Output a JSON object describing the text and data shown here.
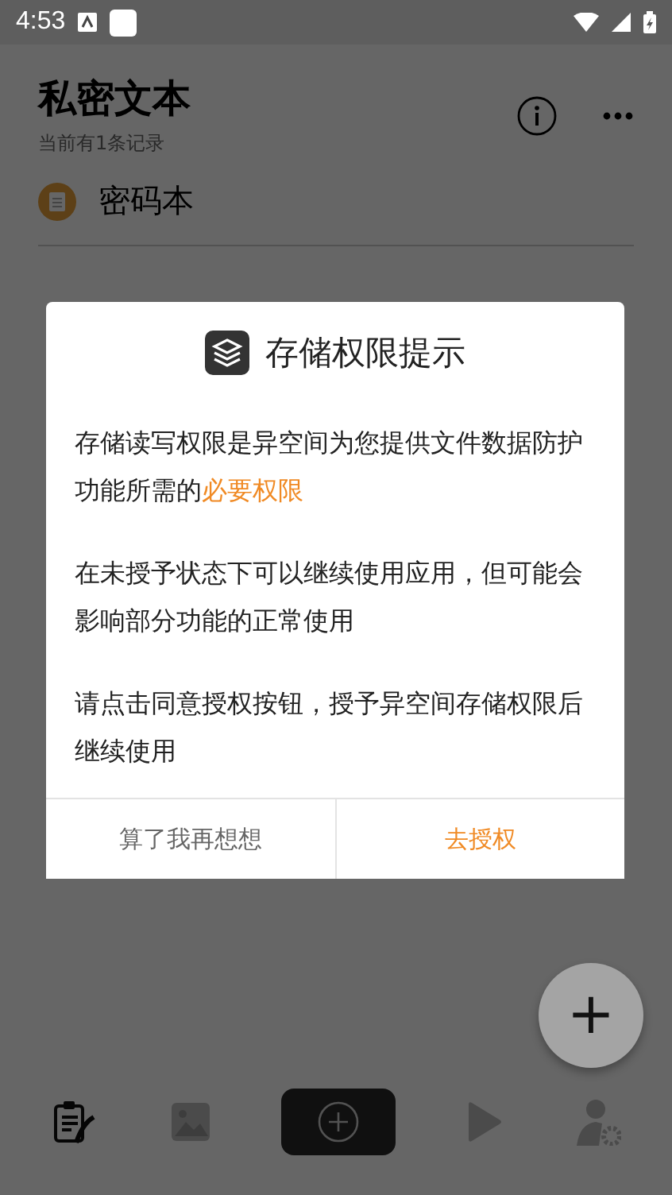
{
  "status_bar": {
    "time": "4:53"
  },
  "app_bar": {
    "title": "私密文本",
    "subtitle": "当前有1条记录"
  },
  "items": [
    {
      "name": "密码本"
    }
  ],
  "dialog": {
    "title": "存储权限提示",
    "paragraphs": [
      {
        "text": "存储读写权限是异空间为您提供文件数据防护功能所需的",
        "link": "必要权限"
      },
      {
        "text": "在未授予状态下可以继续使用应用，但可能会影响部分功能的正常使用"
      },
      {
        "text": "请点击同意授权按钮，授予异空间存储权限后继续使用"
      }
    ],
    "buttons": [
      {
        "label": "算了我再想想",
        "kind": "cancel"
      },
      {
        "label": "去授权",
        "kind": "confirm"
      }
    ]
  },
  "fab": {
    "label": "+"
  },
  "nav": [
    {
      "kind": "notes",
      "selected": true
    },
    {
      "kind": "gallery",
      "selected": false
    },
    {
      "kind": "add",
      "selected": false
    },
    {
      "kind": "video",
      "selected": false
    },
    {
      "kind": "profile",
      "selected": false
    }
  ]
}
